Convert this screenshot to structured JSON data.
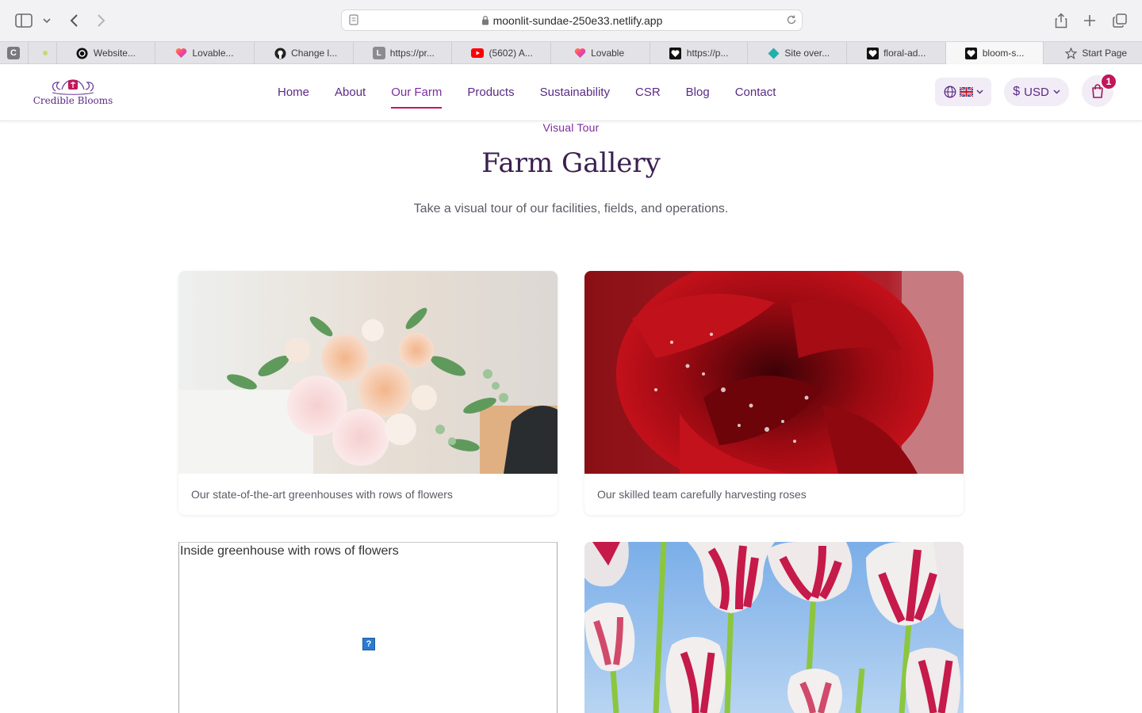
{
  "browser": {
    "url": "moonlit-sundae-250e33.netlify.app",
    "tabs": [
      {
        "label": "",
        "icon": "c-letter-icon"
      },
      {
        "label": "",
        "icon": "dot-icon"
      },
      {
        "label": "Website...",
        "icon": "openai-icon"
      },
      {
        "label": "Lovable...",
        "icon": "heart-icon"
      },
      {
        "label": "Change l...",
        "icon": "github-icon"
      },
      {
        "label": "https://pr...",
        "icon": "l-letter-icon"
      },
      {
        "label": "(5602) A...",
        "icon": "youtube-icon"
      },
      {
        "label": "Lovable",
        "icon": "heart-icon"
      },
      {
        "label": "https://p...",
        "icon": "heart-outline-icon"
      },
      {
        "label": "Site over...",
        "icon": "netlify-icon"
      },
      {
        "label": "floral-ad...",
        "icon": "heart-outline-icon"
      },
      {
        "label": "bloom-s...",
        "icon": "heart-outline-icon"
      },
      {
        "label": "Start Page",
        "icon": "star-icon"
      }
    ]
  },
  "header": {
    "logo_text": "Credible Blooms",
    "nav": [
      "Home",
      "About",
      "Our Farm",
      "Products",
      "Sustainability",
      "CSR",
      "Blog",
      "Contact"
    ],
    "active_nav": "Our Farm",
    "currency": "USD",
    "cart_count": "1",
    "brand_color": "#5b2a86",
    "accent_color": "#c0185a"
  },
  "section": {
    "eyebrow": "Visual Tour",
    "title": "Farm Gallery",
    "subtitle": "Take a visual tour of our facilities, fields, and operations."
  },
  "gallery": [
    {
      "caption": "Our state-of-the-art greenhouses with rows of flowers"
    },
    {
      "caption": "Our skilled team carefully harvesting roses"
    },
    {
      "alt": "Inside greenhouse with rows of flowers"
    },
    {
      "caption": ""
    }
  ]
}
